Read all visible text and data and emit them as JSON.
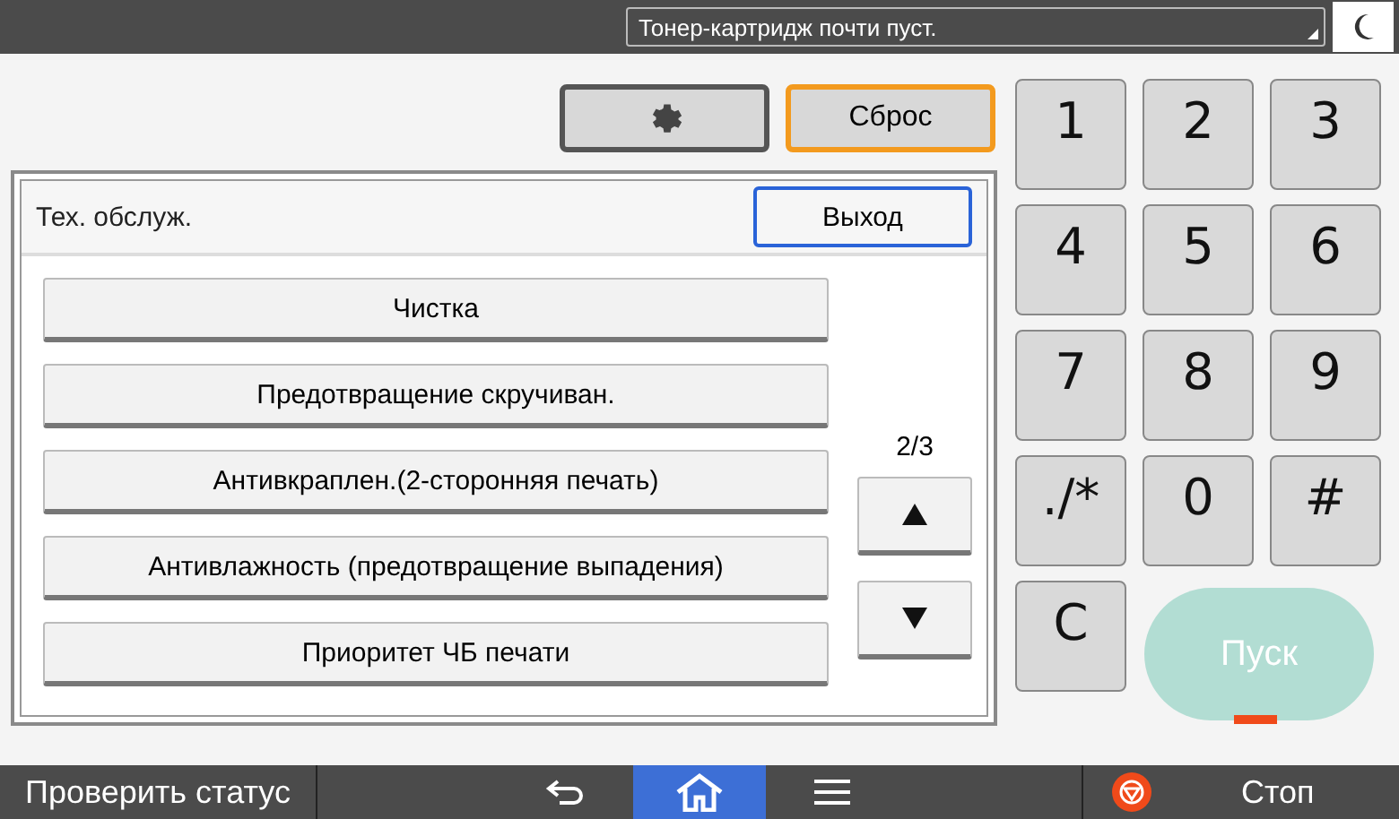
{
  "status_bar": {
    "message": "Тонер-картридж почти пуст."
  },
  "top_buttons": {
    "reset": {
      "label": "Сброс"
    }
  },
  "panel": {
    "title": "Тех. обслуж.",
    "exit": {
      "label": "Выход"
    },
    "page": "2/3",
    "items": [
      {
        "label": "Чистка"
      },
      {
        "label": "Предотвращение скручиван."
      },
      {
        "label": "Антивкраплен.(2-сторонняя печать)"
      },
      {
        "label": "Антивлажность (предотвращение выпадения)"
      },
      {
        "label": "Приоритет ЧБ печати"
      }
    ]
  },
  "keypad": {
    "keys": [
      "1",
      "2",
      "3",
      "4",
      "5",
      "6",
      "7",
      "8",
      "9",
      "./*",
      "0",
      "#",
      "C"
    ],
    "start": {
      "label": "Пуск",
      "disabled": true
    }
  },
  "nav_bar": {
    "check_status": "Проверить статус",
    "items": [
      {
        "kind": "back",
        "selected": false
      },
      {
        "kind": "home",
        "selected": true
      },
      {
        "kind": "menu",
        "selected": false
      }
    ],
    "stop": "Стоп"
  }
}
